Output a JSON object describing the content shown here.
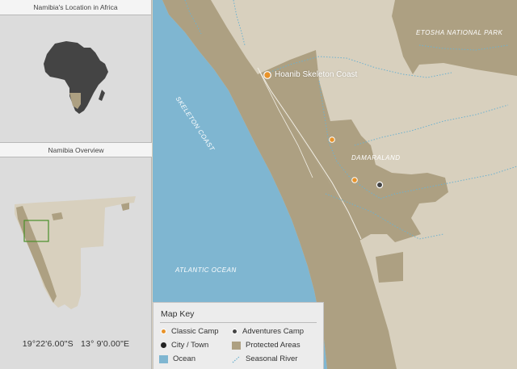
{
  "sidebar": {
    "africa_title": "Namibia's Location in Africa",
    "overview_title": "Namibia Overview",
    "coordinates": {
      "lat": "19°22'6.00\"S",
      "lon": "13° 9'0.00\"E"
    }
  },
  "map": {
    "labels": {
      "etosha": "ETOSHA NATIONAL PARK",
      "skeleton_coast": "SKELETON COAST",
      "damaraland": "DAMARALAND",
      "atlantic": "ATLANTIC OCEAN"
    },
    "camps": [
      {
        "name": "Hoanib Skeleton Coast",
        "type": "classic"
      }
    ]
  },
  "map_key": {
    "title": "Map Key",
    "items": [
      {
        "label": "Classic Camp",
        "icon": "orange-dot-icon",
        "color": "#e8932a"
      },
      {
        "label": "Adventures Camp",
        "icon": "dark-dot-icon",
        "color": "#444444"
      },
      {
        "label": "City / Town",
        "icon": "black-dot-icon",
        "color": "#222222"
      },
      {
        "label": "Protected Areas",
        "icon": "protected-swatch-icon",
        "color": "#ada082"
      },
      {
        "label": "Ocean",
        "icon": "ocean-swatch-icon",
        "color": "#7fb6d1"
      },
      {
        "label": "Seasonal River",
        "icon": "river-line-icon",
        "color": "#6db1cf"
      }
    ]
  },
  "colors": {
    "land": "#d8d0be",
    "protected": "#ada082",
    "ocean": "#7fb6d1",
    "river": "#6db1cf",
    "classic_camp": "#e8932a"
  }
}
